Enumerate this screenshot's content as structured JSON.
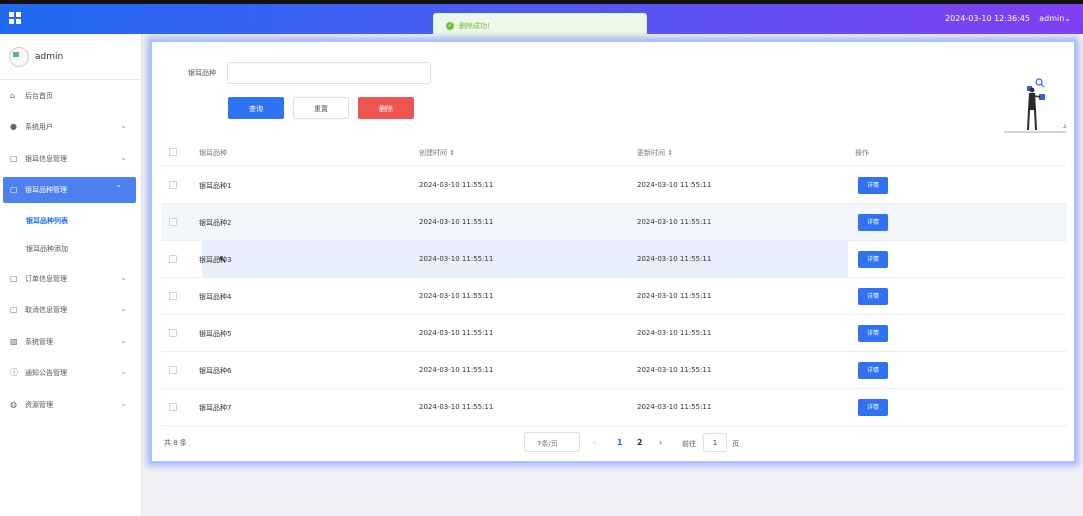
{
  "header": {
    "datetime": "2024-03-10 12:36:45",
    "user": "admin",
    "user_caret": "⌄",
    "grid_icon": "apps-grid-icon"
  },
  "toast": {
    "icon": "✓",
    "message": "删除成功!"
  },
  "sidebar": {
    "profile_name": "admin",
    "items": [
      {
        "label": "后台首页",
        "icon": "⌂",
        "chevron": ""
      },
      {
        "label": "系统用户",
        "icon": "●",
        "chevron": "⌄"
      },
      {
        "label": "银耳信息管理",
        "icon": "▢",
        "chevron": "⌄"
      },
      {
        "label": "银耳品种管理",
        "icon": "▢",
        "chevron": "⌃"
      },
      {
        "label": "订单信息管理",
        "icon": "▢",
        "chevron": "⌄"
      },
      {
        "label": "取消信息管理",
        "icon": "▢",
        "chevron": "⌄"
      },
      {
        "label": "系统管理",
        "icon": "▨",
        "chevron": "⌄"
      },
      {
        "label": "通知公告管理",
        "icon": "ⓘ",
        "chevron": "⌄"
      },
      {
        "label": "资源管理",
        "icon": "◍",
        "chevron": "⌄"
      }
    ],
    "sub_items": [
      "银耳品种列表",
      "银耳品种添加"
    ]
  },
  "search": {
    "label": "银耳品种",
    "value": ""
  },
  "buttons": {
    "query": "查询",
    "reset": "重置",
    "delete": "删除"
  },
  "table": {
    "columns": [
      "银耳品种",
      "创建时间 ⇕",
      "更新时间 ⇕",
      "操作"
    ],
    "rows": [
      {
        "name": "银耳品种1",
        "created": "2024-03-10 11:55:11",
        "updated": "2024-03-10 11:55:11",
        "action": "详情"
      },
      {
        "name": "银耳品种2",
        "created": "2024-03-10 11:55:11",
        "updated": "2024-03-10 11:55:11",
        "action": "详情"
      },
      {
        "name": "银耳品种3",
        "created": "2024-03-10 11:55:11",
        "updated": "2024-03-10 11:55:11",
        "action": "详情"
      },
      {
        "name": "银耳品种4",
        "created": "2024-03-10 11:55:11",
        "updated": "2024-03-10 11:55:11",
        "action": "详情"
      },
      {
        "name": "银耳品种5",
        "created": "2024-03-10 11:55:11",
        "updated": "2024-03-10 11:55:11",
        "action": "详情"
      },
      {
        "name": "银耳品种6",
        "created": "2024-03-10 11:55:11",
        "updated": "2024-03-10 11:55:11",
        "action": "详情"
      },
      {
        "name": "银耳品种7",
        "created": "2024-03-10 11:55:11",
        "updated": "2024-03-10 11:55:11",
        "action": "详情"
      }
    ]
  },
  "pagination": {
    "total": "共 8 条",
    "page_size": "7条/页",
    "page_size_caret": "⌄",
    "prev": "‹",
    "next": "›",
    "pages": [
      "1",
      "2"
    ],
    "goto_label": "前往",
    "goto_value": "1",
    "goto_unit": "页"
  },
  "colors": {
    "primary": "#2f73f1",
    "danger": "#ec5552",
    "success": "#67c23a"
  }
}
